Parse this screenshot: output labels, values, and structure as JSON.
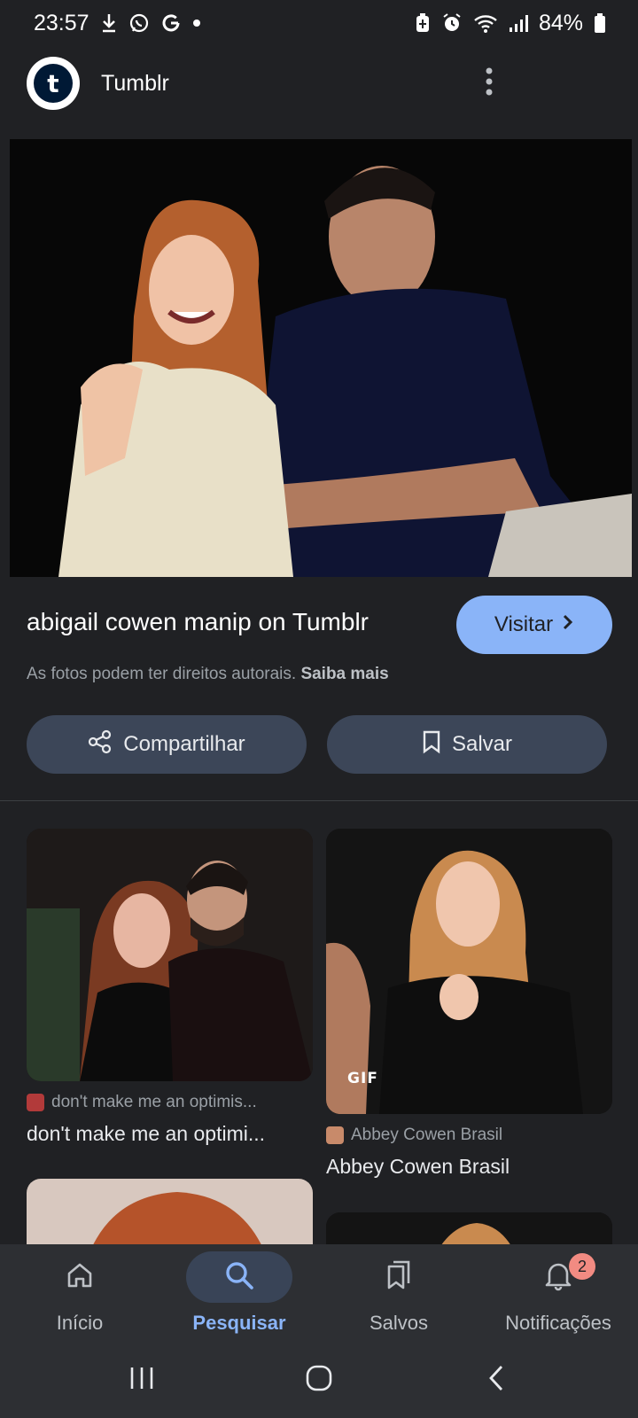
{
  "status_bar": {
    "time": "23:57",
    "battery": "84%"
  },
  "header": {
    "site_name": "Tumblr",
    "logo_letter": "t"
  },
  "result": {
    "title": "abigail cowen manip on Tumblr",
    "visit_label": "Visitar",
    "copyright_text": "As fotos podem ter direitos autorais.",
    "learn_more": "Saiba mais",
    "share_label": "Compartilhar",
    "save_label": "Salvar"
  },
  "related": [
    {
      "source": "don't make me an optimis...",
      "title": "don't make me an optimi...",
      "badge": ""
    },
    {
      "source": "Abbey Cowen Brasil",
      "title": "Abbey Cowen Brasil",
      "badge": "GIF"
    }
  ],
  "bottom_nav": [
    {
      "label": "Início",
      "icon": "home-icon"
    },
    {
      "label": "Pesquisar",
      "icon": "search-icon"
    },
    {
      "label": "Salvos",
      "icon": "bookmarks-icon"
    },
    {
      "label": "Notificações",
      "icon": "bell-icon",
      "badge": "2"
    }
  ],
  "colors": {
    "background": "#202124",
    "accent": "#8ab4f8",
    "button": "#3c4658",
    "badge": "#f28b82"
  }
}
